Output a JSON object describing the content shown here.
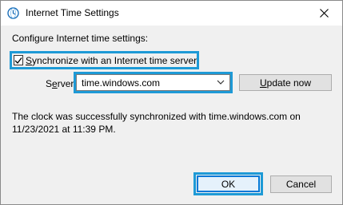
{
  "window": {
    "title": "Internet Time Settings",
    "icon": "clock-globe-icon",
    "close_icon": "close-icon"
  },
  "dialog": {
    "heading": "Configure Internet time settings:",
    "sync_checkbox": {
      "checked": true,
      "label_prefix": "",
      "label_underlined": "S",
      "label_rest": "ynchronize with an Internet time server"
    },
    "server": {
      "label_underlined": "e",
      "label_before": "S",
      "label_after": "rver:",
      "value": "time.windows.com"
    },
    "update_button": {
      "underlined": "U",
      "rest": "pdate now"
    },
    "status_message": "The clock was successfully synchronized with time.windows.com on 11/23/2021 at 11:39 PM.",
    "buttons": {
      "ok": "OK",
      "cancel": "Cancel"
    }
  },
  "colors": {
    "highlight": "#1e9ad6",
    "window_bg": "#f0f0f0",
    "button_bg": "#e1e1e1"
  }
}
